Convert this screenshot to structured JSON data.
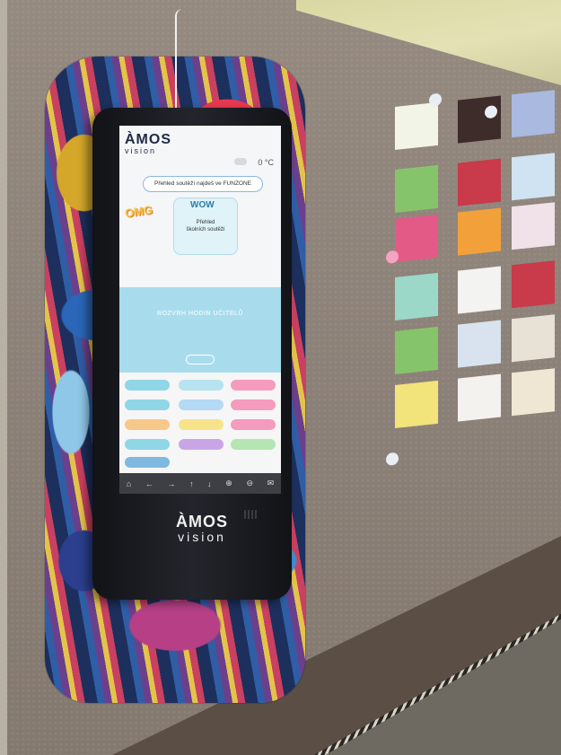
{
  "kiosk_screen": {
    "logo_main": "ÀMOS",
    "logo_sub": "vision",
    "temperature": "0 °C",
    "banner": "Přehled soutěží najdeš ve FUNZONE",
    "omg": "OMG",
    "promo_title": "WOW",
    "promo_line1": "Přehled",
    "promo_line2": "školních soutěží",
    "schedule": "ROZVRH HODIN UČITELŮ"
  },
  "kiosk_brand": {
    "logo_main": "ÀMOS",
    "logo_sub": "vision"
  },
  "colors": {
    "screen_mid": "#a8dced",
    "kiosk_body": "#1b1c22",
    "wall": "#8c8178",
    "tiles": [
      "#8fd6e6",
      "#b6e3ef",
      "#f59bbd",
      "#f8c88a",
      "#f7e48a",
      "#f59bbd",
      "#b3d9f5",
      "#c8a6e6",
      "#b3e6b0"
    ]
  },
  "puzzle_colors": [
    "#f2f4e8",
    "#f0e6f0",
    "#cfe3f2",
    "#86c46b",
    "#3d2c2a",
    "#a9b9df",
    "#e35a86",
    "#f2a13a",
    "#d9e7f3",
    "#f4f2ee",
    "#efe6d4",
    "#f0e2e8",
    "#9bd8c8",
    "#f3f3f1",
    "#c93a4a",
    "#f2e37a",
    "#e7e1d6",
    "#d8e3ef"
  ]
}
